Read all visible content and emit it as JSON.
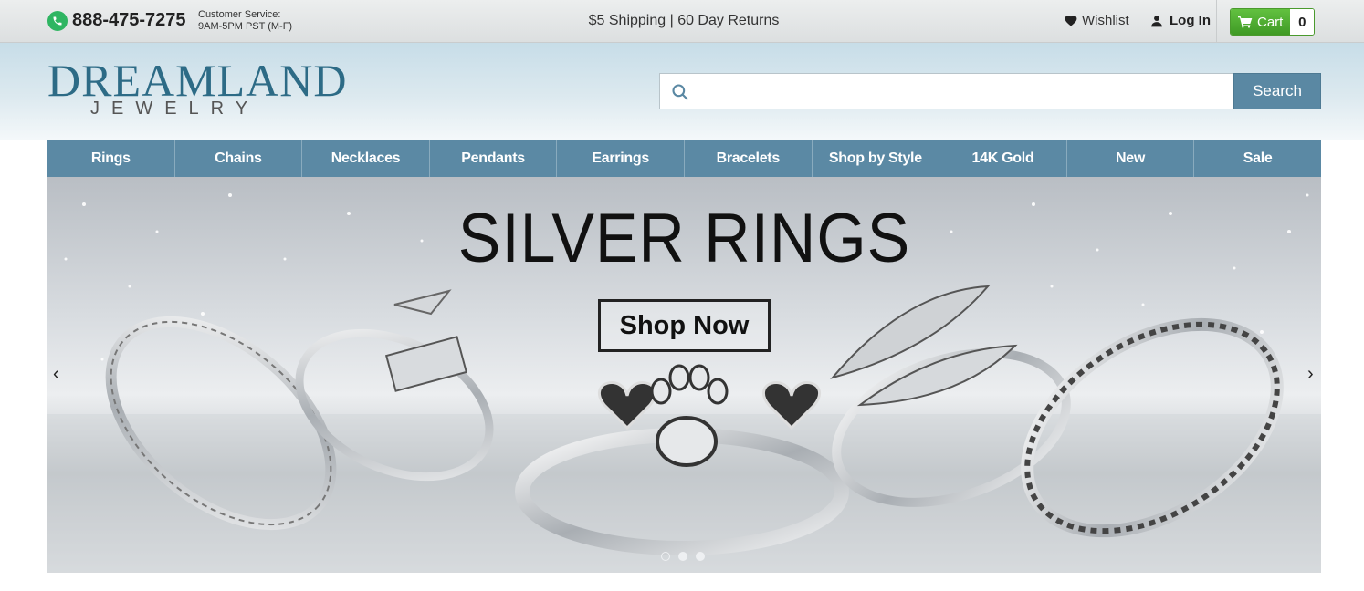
{
  "topbar": {
    "phone": "888-475-7275",
    "customer_service_label": "Customer Service:",
    "customer_service_hours": "9AM-5PM PST (M-F)",
    "promo": "$5 Shipping | 60 Day Returns",
    "wishlist": "Wishlist",
    "login": "Log In",
    "cart_label": "Cart",
    "cart_count": "0"
  },
  "header": {
    "logo_top": "DREAMLAND",
    "logo_bottom": "JEWELRY",
    "search": {
      "placeholder": "",
      "value": "",
      "button": "Search"
    }
  },
  "nav": {
    "items": [
      "Rings",
      "Chains",
      "Necklaces",
      "Pendants",
      "Earrings",
      "Bracelets",
      "Shop by Style",
      "14K Gold",
      "New",
      "Sale"
    ]
  },
  "hero": {
    "title": "SILVER RINGS",
    "cta": "Shop Now",
    "prev": "‹",
    "next": "›",
    "slide_count": 3,
    "active_slide": 1
  },
  "colors": {
    "nav_bg": "#5b89a4",
    "cart_green": "#4aa52f",
    "phone_green": "#2fb562",
    "logo_blue": "#2d6b86"
  },
  "icons": [
    "phone-icon",
    "heart-icon",
    "user-icon",
    "cart-icon",
    "search-icon",
    "chevron-left-icon",
    "chevron-right-icon"
  ]
}
